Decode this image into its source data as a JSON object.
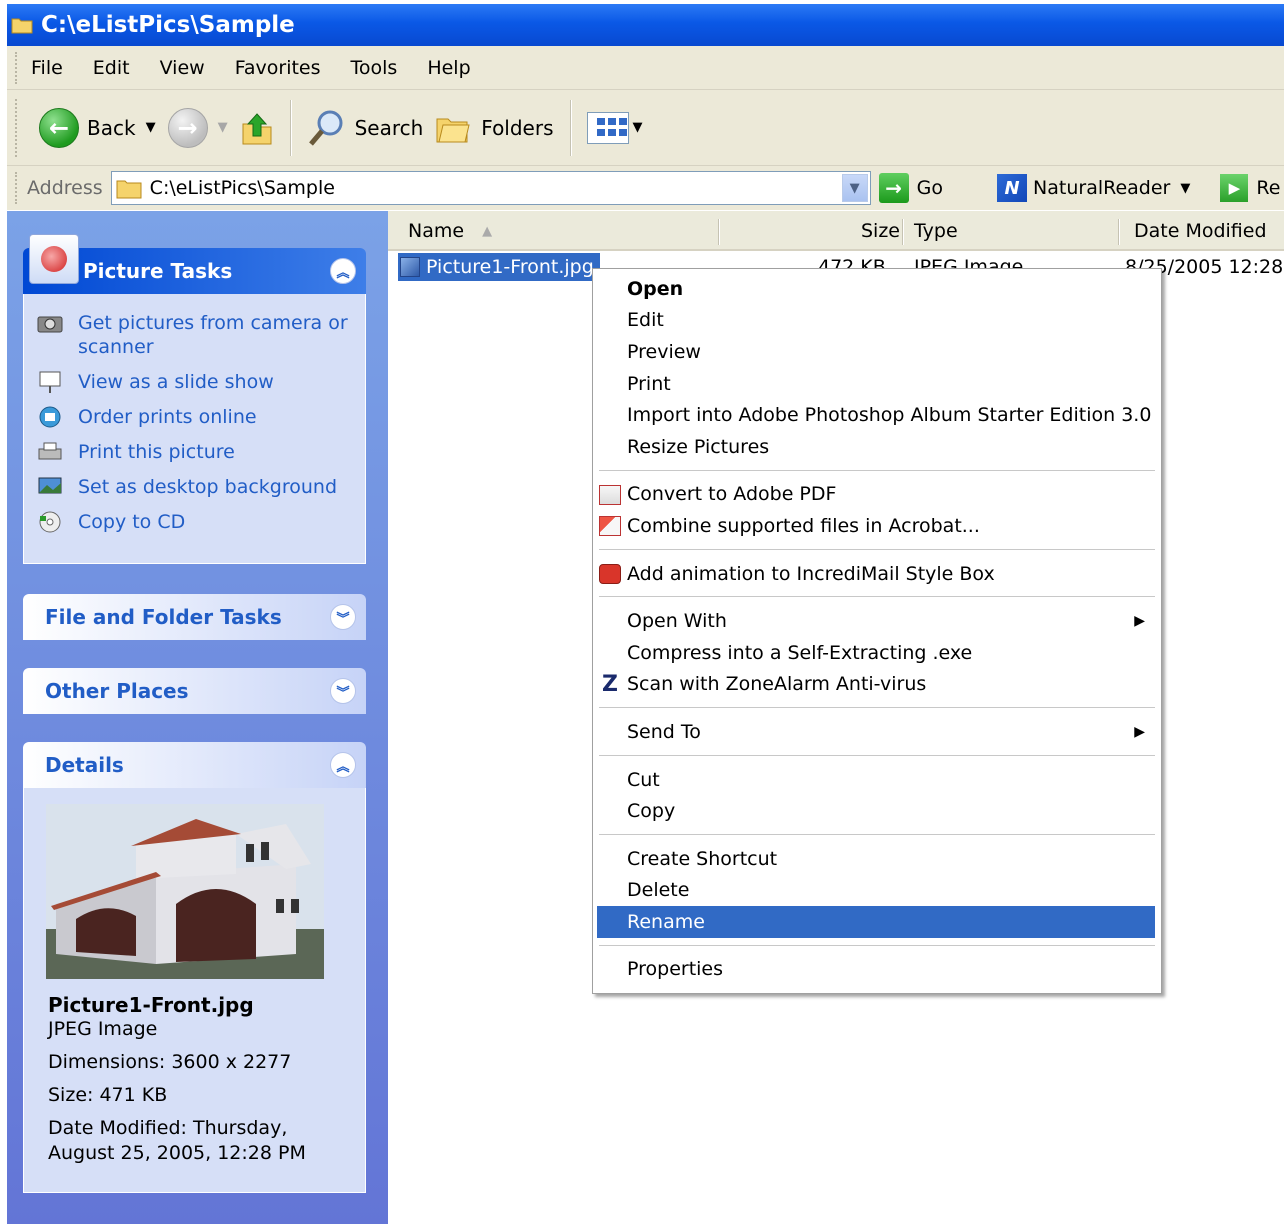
{
  "window": {
    "title": "C:\\eListPics\\Sample"
  },
  "menu": [
    "File",
    "Edit",
    "View",
    "Favorites",
    "Tools",
    "Help"
  ],
  "toolbar": {
    "back": "Back",
    "search": "Search",
    "folders": "Folders"
  },
  "address": {
    "label": "Address",
    "path": "C:\\eListPics\\Sample",
    "go": "Go",
    "natural_reader": "NaturalReader",
    "truncated": "Re"
  },
  "left": {
    "picture_tasks": {
      "title": "Picture Tasks",
      "items": [
        {
          "icon": "camera-icon",
          "label": "Get pictures from camera or scanner"
        },
        {
          "icon": "slideshow-icon",
          "label": "View as a slide show"
        },
        {
          "icon": "order-prints-icon",
          "label": "Order prints online"
        },
        {
          "icon": "printer-icon",
          "label": "Print this picture"
        },
        {
          "icon": "desktop-icon",
          "label": "Set as desktop background"
        },
        {
          "icon": "cd-icon",
          "label": "Copy to CD"
        }
      ]
    },
    "file_folder_tasks": {
      "title": "File and Folder Tasks"
    },
    "other_places": {
      "title": "Other Places"
    },
    "details": {
      "title": "Details",
      "name": "Picture1-Front.jpg",
      "type": "JPEG Image",
      "dimensions": "Dimensions: 3600 x 2277",
      "size": "Size: 471 KB",
      "modified": "Date Modified: Thursday, August 25, 2005, 12:28 PM"
    }
  },
  "columns": {
    "name": "Name",
    "size": "Size",
    "type": "Type",
    "date": "Date Modified"
  },
  "file": {
    "name": "Picture1-Front.jpg",
    "size": "472 KB",
    "type": "JPEG Image",
    "date": "8/25/2005 12:28"
  },
  "context_menu": {
    "open": "Open",
    "edit": "Edit",
    "preview": "Preview",
    "print": "Print",
    "import": "Import into Adobe Photoshop Album Starter Edition 3.0",
    "resize": "Resize Pictures",
    "convert_pdf": "Convert to Adobe PDF",
    "combine_acrobat": "Combine supported files in Acrobat...",
    "incredimail": "Add animation to IncrediMail Style Box",
    "open_with": "Open With",
    "compress": "Compress into a Self-Extracting .exe",
    "scan": "Scan with ZoneAlarm Anti-virus",
    "send_to": "Send To",
    "cut": "Cut",
    "copy": "Copy",
    "create_shortcut": "Create Shortcut",
    "delete": "Delete",
    "rename": "Rename",
    "properties": "Properties"
  },
  "colors": {
    "title_bar": "#0a58e6",
    "selection": "#316ac5",
    "task_pane": "#6f8ddc",
    "link": "#215dc6"
  }
}
